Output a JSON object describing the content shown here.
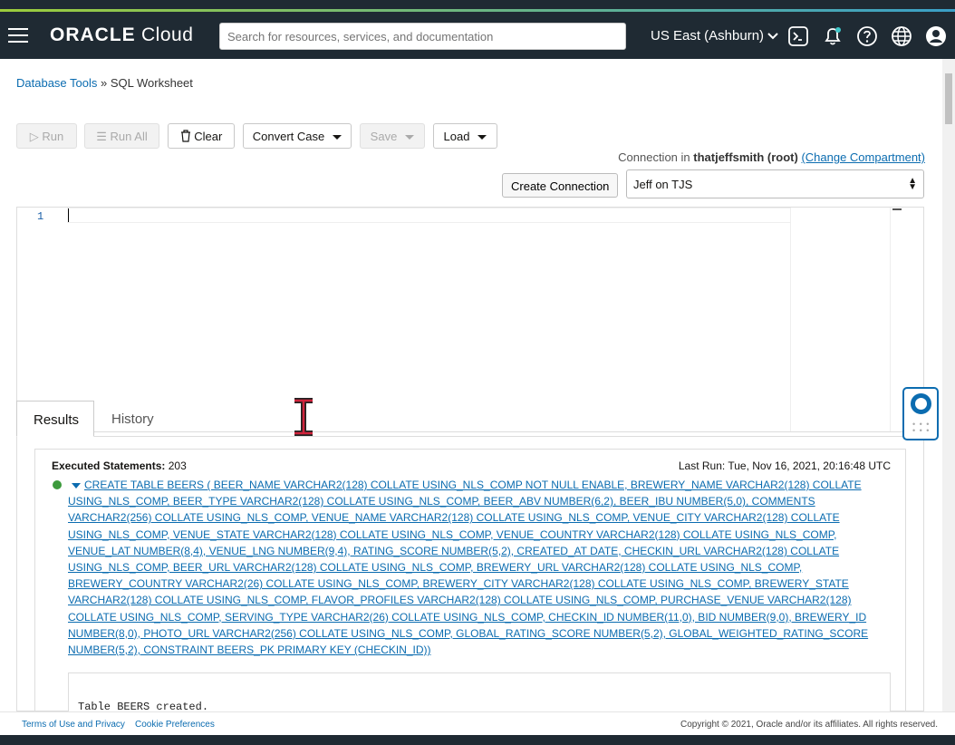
{
  "header": {
    "logo_brand": "ORACLE",
    "logo_product": "Cloud",
    "search_placeholder": "Search for resources, services, and documentation",
    "region": "US East (Ashburn)",
    "icons": [
      "terminal-icon",
      "bell-icon",
      "help-icon",
      "globe-icon",
      "user-icon"
    ]
  },
  "breadcrumb": {
    "parent": "Database Tools",
    "separator": "»",
    "current": "SQL Worksheet"
  },
  "toolbar": {
    "run": "Run",
    "run_all": "Run All",
    "clear": "Clear",
    "convert_case": "Convert Case",
    "save": "Save",
    "load": "Load"
  },
  "connection": {
    "prefix": "Connection in",
    "compartment": "thatjeffsmith (root)",
    "change_link": "(Change Compartment)",
    "create_button": "Create Connection",
    "selected": "Jeff on TJS"
  },
  "editor": {
    "line_number": "1"
  },
  "tabs": {
    "results": "Results",
    "history": "History"
  },
  "results": {
    "executed_label": "Executed Statements:",
    "executed_count": "203",
    "last_run": "Last Run: Tue, Nov 16, 2021, 20:16:48 UTC",
    "statement": "CREATE TABLE BEERS ( BEER_NAME VARCHAR2(128) COLLATE USING_NLS_COMP NOT NULL ENABLE, BREWERY_NAME VARCHAR2(128) COLLATE USING_NLS_COMP, BEER_TYPE VARCHAR2(128) COLLATE USING_NLS_COMP, BEER_ABV NUMBER(6,2), BEER_IBU NUMBER(5,0), COMMENTS VARCHAR2(256) COLLATE USING_NLS_COMP, VENUE_NAME VARCHAR2(128) COLLATE USING_NLS_COMP, VENUE_CITY VARCHAR2(128) COLLATE USING_NLS_COMP, VENUE_STATE VARCHAR2(128) COLLATE USING_NLS_COMP, VENUE_COUNTRY VARCHAR2(128) COLLATE USING_NLS_COMP, VENUE_LAT NUMBER(8,4), VENUE_LNG NUMBER(9,4), RATING_SCORE NUMBER(5,2), CREATED_AT DATE, CHECKIN_URL VARCHAR2(128) COLLATE USING_NLS_COMP, BEER_URL VARCHAR2(128) COLLATE USING_NLS_COMP, BREWERY_URL VARCHAR2(128) COLLATE USING_NLS_COMP, BREWERY_COUNTRY VARCHAR2(26) COLLATE USING_NLS_COMP, BREWERY_CITY VARCHAR2(128) COLLATE USING_NLS_COMP, BREWERY_STATE VARCHAR2(128) COLLATE USING_NLS_COMP, FLAVOR_PROFILES VARCHAR2(128) COLLATE USING_NLS_COMP, PURCHASE_VENUE VARCHAR2(128) COLLATE USING_NLS_COMP, SERVING_TYPE VARCHAR2(26) COLLATE USING_NLS_COMP, CHECKIN_ID NUMBER(11,0), BID NUMBER(9,0), BREWERY_ID NUMBER(8,0), PHOTO_URL VARCHAR2(256) COLLATE USING_NLS_COMP, GLOBAL_RATING_SCORE NUMBER(5,2), GLOBAL_WEIGHTED_RATING_SCORE NUMBER(5,2), CONSTRAINT BEERS_PK PRIMARY KEY (CHECKIN_ID))",
    "output": "Table BEERS created."
  },
  "footer": {
    "terms": "Terms of Use and Privacy",
    "cookies": "Cookie Preferences",
    "copyright": "Copyright © 2021, Oracle and/or its affiliates. All rights reserved."
  },
  "colors": {
    "header_bg": "#1f2a33",
    "link": "#0b6cb0",
    "success": "#3c9a3c"
  }
}
